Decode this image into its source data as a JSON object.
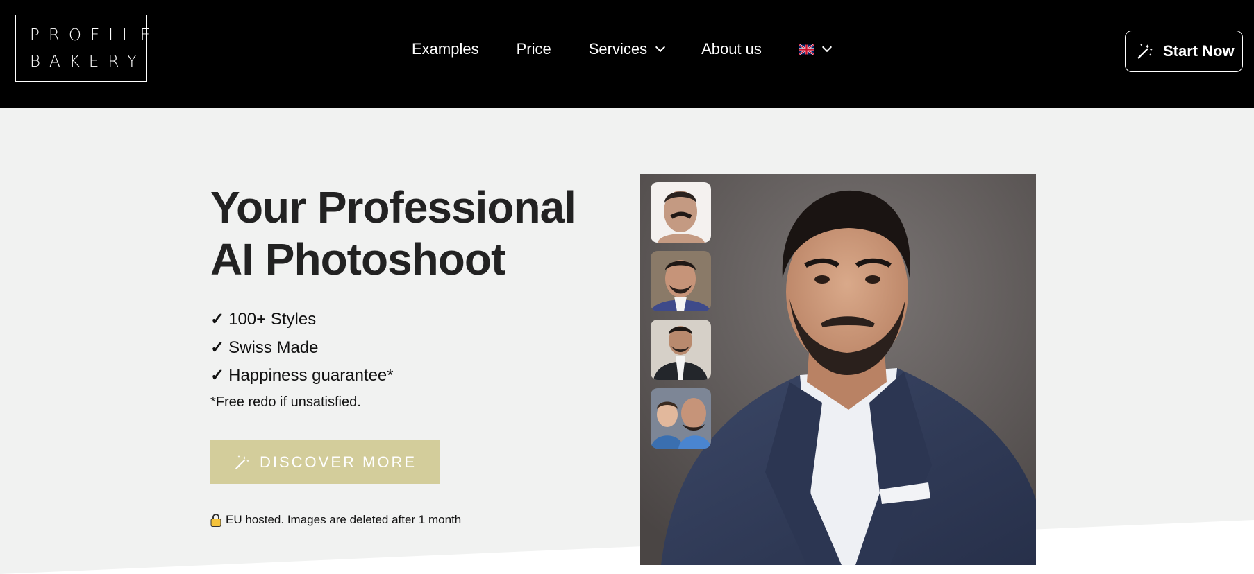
{
  "brand": {
    "logo_line1": "PROFILE",
    "logo_line2": "BAKERY"
  },
  "nav": {
    "items": [
      {
        "label": "Examples"
      },
      {
        "label": "Price"
      },
      {
        "label": "Services",
        "has_dropdown": true
      },
      {
        "label": "About us"
      }
    ],
    "language": {
      "icon": "uk-flag-icon",
      "has_dropdown": true
    }
  },
  "header": {
    "cta_label": "Start Now",
    "cta_icon": "magic-wand-icon"
  },
  "hero": {
    "title_line1": "Your Professional",
    "title_line2": "AI Photoshoot",
    "features": [
      "100+ Styles",
      "Swiss Made",
      "Happiness guarantee*"
    ],
    "check_glyph": "✓",
    "note": "*Free redo if unsatisfied.",
    "cta_label": "DISCOVER MORE",
    "privacy_text": "EU hosted. Images are deleted after 1 month",
    "privacy_icon": "lock-icon"
  },
  "colors": {
    "header_bg": "#000000",
    "page_bg": "#f1f2f1",
    "accent": "#d3cd9b",
    "text": "#222222"
  }
}
